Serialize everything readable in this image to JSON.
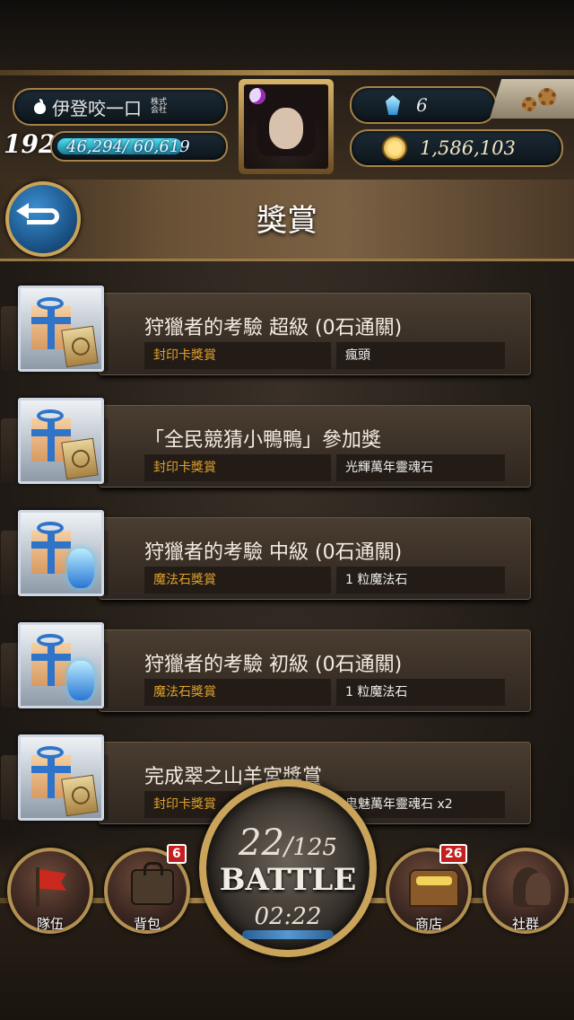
{
  "header": {
    "player_name": "伊登咬一口",
    "corp_tag": "株式会社",
    "level": "192",
    "exp_text": "46,294/ 60,619",
    "exp_fraction": 0.7637,
    "gems": "6",
    "coins": "1,586,103"
  },
  "page": {
    "title": "獎賞"
  },
  "rewards": [
    {
      "title": "狩獵者的考驗 超級 (0石通關)",
      "type": "封印卡獎賞",
      "item": "瘋頭",
      "icon": "gift-card"
    },
    {
      "title": "「全民競猜小鴨鴨」參加獎",
      "type": "封印卡獎賞",
      "item": "光輝萬年靈魂石",
      "icon": "gift-card"
    },
    {
      "title": "狩獵者的考驗 中級 (0石通關)",
      "type": "魔法石獎賞",
      "item": "1 粒魔法石",
      "icon": "gift-stone"
    },
    {
      "title": "狩獵者的考驗 初級 (0石通關)",
      "type": "魔法石獎賞",
      "item": "1 粒魔法石",
      "icon": "gift-stone"
    },
    {
      "title": "完成翠之山羊宮獎賞",
      "type": "封印卡獎賞",
      "item": "鬼魅萬年靈魂石 x2",
      "icon": "gift-card"
    }
  ],
  "nav": {
    "team": "隊伍",
    "bag": "背包",
    "bag_badge": "6",
    "shop": "商店",
    "shop_badge": "26",
    "social": "社群"
  },
  "battle": {
    "stamina_current": "22",
    "stamina_sep": "/",
    "stamina_max": "125",
    "label": "BATTLE",
    "timer": "02:22"
  },
  "colors": {
    "accent_gold": "#c9a45a",
    "reward_type": "#e0a12c",
    "badge_red": "#c41f1f"
  }
}
